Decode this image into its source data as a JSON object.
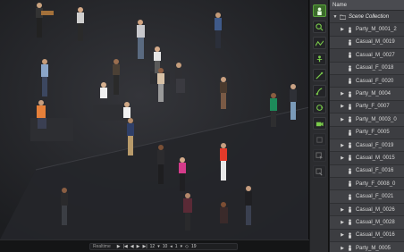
{
  "scene_tree": {
    "header": "Name",
    "root": {
      "label": "Scene Collection",
      "expanded": true
    },
    "items": [
      {
        "label": "Party_M_0001_2",
        "expandable": true
      },
      {
        "label": "Casual_M_0019",
        "expandable": false
      },
      {
        "label": "Casual_M_0027",
        "expandable": false
      },
      {
        "label": "Casual_F_0018",
        "expandable": false
      },
      {
        "label": "Casual_F_0020",
        "expandable": false
      },
      {
        "label": "Party_M_0004",
        "expandable": true
      },
      {
        "label": "Party_F_0007",
        "expandable": true
      },
      {
        "label": "Party_M_0003_0",
        "expandable": true
      },
      {
        "label": "Party_F_0005",
        "expandable": false
      },
      {
        "label": "Casual_F_0019",
        "expandable": true
      },
      {
        "label": "Casual_M_0015",
        "expandable": true
      },
      {
        "label": "Casual_F_0016",
        "expandable": false
      },
      {
        "label": "Party_F_0008_0",
        "expandable": false
      },
      {
        "label": "Casual_F_0021",
        "expandable": false
      },
      {
        "label": "Casual_M_0026",
        "expandable": true
      },
      {
        "label": "Casual_M_0028",
        "expandable": true
      },
      {
        "label": "Casual_M_0016",
        "expandable": true
      },
      {
        "label": "Party_M_0005",
        "expandable": true
      }
    ]
  },
  "timeline": {
    "label": "Realtime",
    "frame_current": "12",
    "frame_step": "10",
    "frame_value": "1",
    "frame_end": "19"
  },
  "toolbar": {
    "tools": [
      "person-icon",
      "pick-icon",
      "curve-icon",
      "figure-icon",
      "wand-icon",
      "brush-icon",
      "loop-icon",
      "camera-icon",
      "blank-icon",
      "select-icon",
      "export-icon"
    ]
  },
  "colors": {
    "accent_green": "#5aa33c",
    "viewport_bg": "#1f2023",
    "panel_bg": "#3a3b3f"
  }
}
